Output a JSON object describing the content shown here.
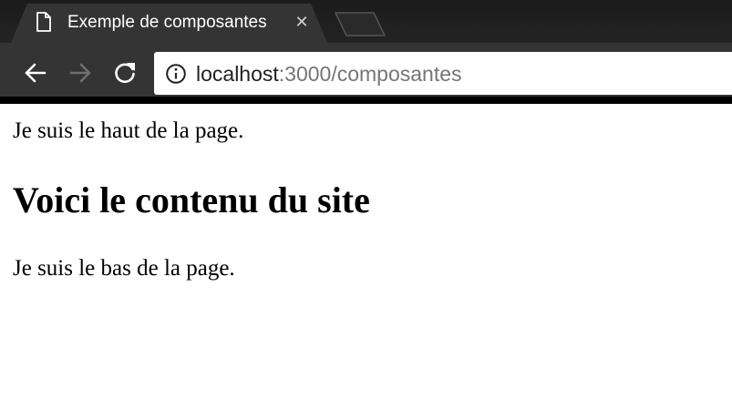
{
  "browser": {
    "tab": {
      "title": "Exemple de composantes",
      "icon": "document-icon",
      "close_glyph": "✕"
    },
    "toolbar": {
      "back_icon": "arrow-left-icon",
      "forward_icon": "arrow-right-icon",
      "reload_icon": "reload-icon",
      "info_icon": "info-icon",
      "url_host": "localhost",
      "url_path": ":3000/composantes"
    },
    "colors": {
      "tabstrip": "#202020",
      "toolbar": "#343434",
      "url_host": "#202124",
      "url_path": "#757575"
    }
  },
  "page": {
    "top_text": "Je suis le haut de la page.",
    "heading": "Voici le contenu du site",
    "bottom_text": "Je suis le bas de la page."
  }
}
